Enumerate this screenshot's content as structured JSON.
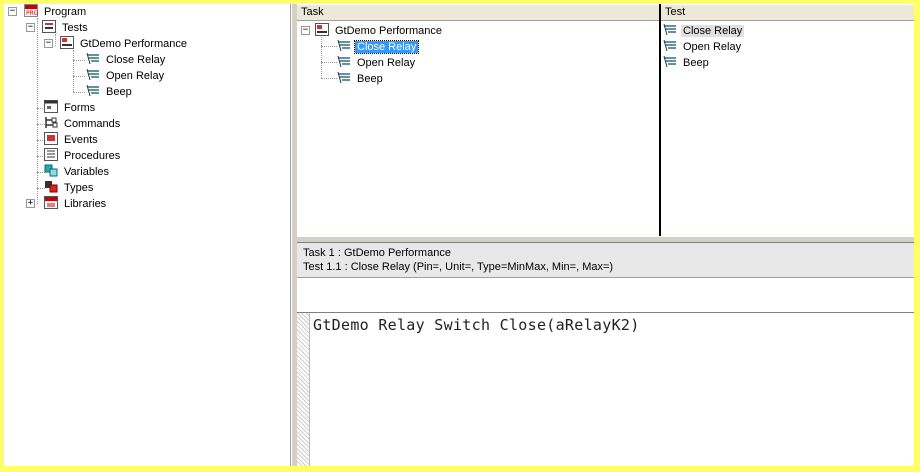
{
  "tree": {
    "root": {
      "label": "Program",
      "icon": "prg-icon"
    },
    "tests": {
      "label": "Tests",
      "icon": "tests-icon"
    },
    "task": {
      "label": "GtDemo Performance",
      "icon": "task-icon"
    },
    "test_items": [
      {
        "label": "Close Relay",
        "icon": "test-icon"
      },
      {
        "label": "Open Relay",
        "icon": "test-icon"
      },
      {
        "label": "Beep",
        "icon": "test-icon"
      }
    ],
    "nodes": [
      {
        "label": "Forms",
        "icon": "forms-icon"
      },
      {
        "label": "Commands",
        "icon": "commands-icon"
      },
      {
        "label": "Events",
        "icon": "events-icon"
      },
      {
        "label": "Procedures",
        "icon": "procedures-icon"
      },
      {
        "label": "Variables",
        "icon": "variables-icon"
      },
      {
        "label": "Types",
        "icon": "types-icon"
      },
      {
        "label": "Libraries",
        "icon": "libraries-icon"
      }
    ]
  },
  "task_pane": {
    "header": "Task",
    "task": "GtDemo Performance",
    "items": [
      "Close Relay",
      "Open Relay",
      "Beep"
    ]
  },
  "test_pane": {
    "header": "Test",
    "items": [
      "Close Relay",
      "Open Relay",
      "Beep"
    ]
  },
  "info": {
    "line1": "Task 1 : GtDemo Performance",
    "line2": "Test 1.1 : Close Relay (Pin=, Unit=, Type=MinMax, Min=, Max=)"
  },
  "code": {
    "line1": "GtDemo Relay Switch Close(aRelayK2)"
  },
  "colors": {
    "border": "#ffff66",
    "selection": "#3399ff"
  }
}
